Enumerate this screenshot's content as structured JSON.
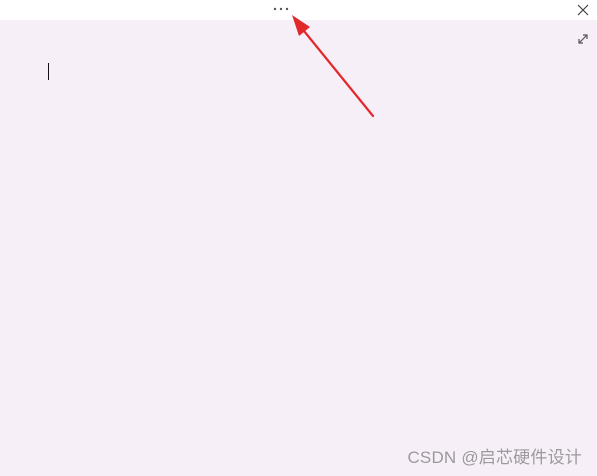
{
  "window": {
    "menu_icon": "more-horizontal-icon",
    "close_icon": "close-icon",
    "expand_icon": "expand-icon"
  },
  "note": {
    "content": "",
    "background_color": "#f7eff8"
  },
  "annotation": {
    "arrow_color": "#e3282b"
  },
  "watermark": {
    "text": "CSDN @启芯硬件设计"
  }
}
